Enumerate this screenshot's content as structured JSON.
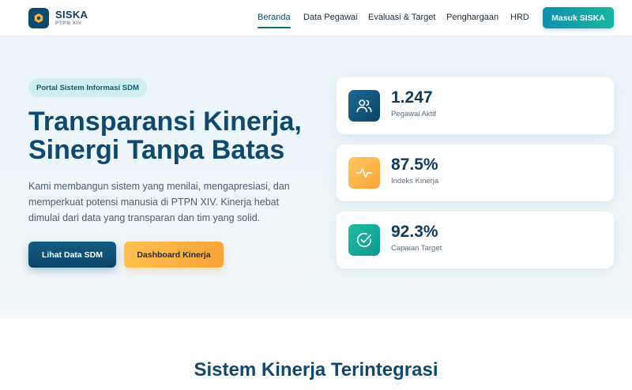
{
  "header": {
    "logo_title": "SISKA",
    "logo_sub": "PTPN XIV",
    "nav": [
      {
        "label": "Beranda",
        "active": true
      },
      {
        "label": "Data Pegawai",
        "active": false
      },
      {
        "label": "Evaluasi & Target",
        "active": false
      },
      {
        "label": "Penghargaan",
        "active": false
      },
      {
        "label": "HRD",
        "active": false
      }
    ],
    "login_label": "Masuk SISKA"
  },
  "hero": {
    "badge": "Portal Sistem Informasi SDM",
    "title_line1": "Transparansi Kinerja,",
    "title_line2": "Sinergi Tanpa Batas",
    "description": "Kami membangun sistem yang menilai, mengapresiasi, dan memperkuat potensi manusia di PTPN XIV. Kinerja hebat dimulai dari data yang transparan dan tim yang solid.",
    "primary_button": "Lihat Data SDM",
    "secondary_button": "Dashboard Kinerja"
  },
  "stats": [
    {
      "value": "1.247",
      "label": "Pegawai Aktif",
      "icon": "users-icon",
      "color": "#0f4a6e"
    },
    {
      "value": "87.5%",
      "label": "Indeks Kinerja",
      "icon": "activity-icon",
      "color": "#f9a43a"
    },
    {
      "value": "92.3%",
      "label": "Capaian Target",
      "icon": "check-circle-icon",
      "color": "#14a99a"
    }
  ],
  "section": {
    "title": "Sistem Kinerja Terintegrasi"
  },
  "colors": {
    "primary": "#0f4a6e",
    "accent": "#1bb59e",
    "warning": "#f9a43a"
  }
}
